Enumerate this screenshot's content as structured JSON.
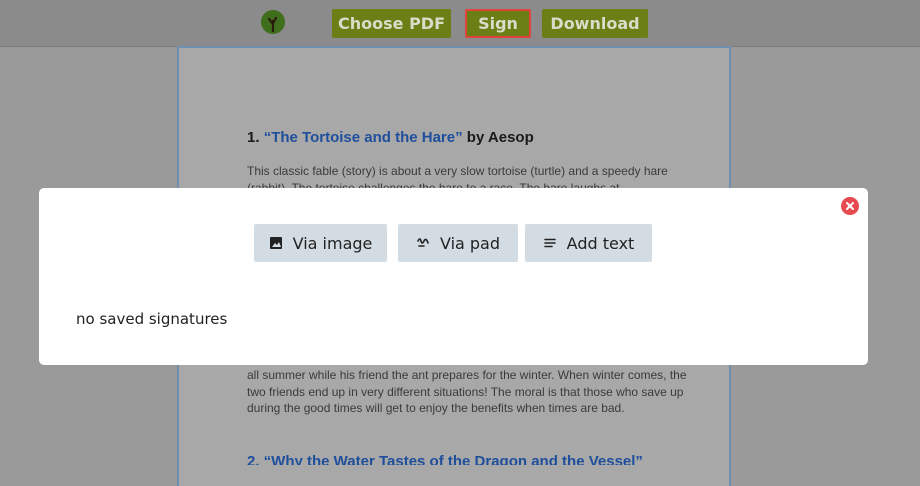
{
  "toolbar": {
    "logo_icon": "tree-logo",
    "choose_pdf_label": "Choose PDF",
    "sign_label": "Sign",
    "download_label": "Download",
    "button_color": "#6b7f16",
    "sign_highlight_color": "#e0433a"
  },
  "document": {
    "heading_number": "1.",
    "heading_title": "“The Tortoise and the Hare”",
    "heading_author": "by Aesop",
    "paragraph_top": "This classic fable (story) is about a very slow tortoise (turtle) and a speedy hare (rabbit). The tortoise challenges the hare to a race. The hare laughs at",
    "paragraph_bottom": "all summer while his friend the ant prepares for the winter. When winter comes, the two friends end up in very different situations! The moral is that those who save up during the good times will get to enjoy the benefits when times are bad.",
    "heading2_partial": "2. “Why the Water Tastes of the Dragon and the Vessel”"
  },
  "modal": {
    "close_icon": "close-icon",
    "via_image_label": "Via image",
    "via_pad_label": "Via pad",
    "add_text_label": "Add text",
    "empty_message": "no saved signatures"
  }
}
